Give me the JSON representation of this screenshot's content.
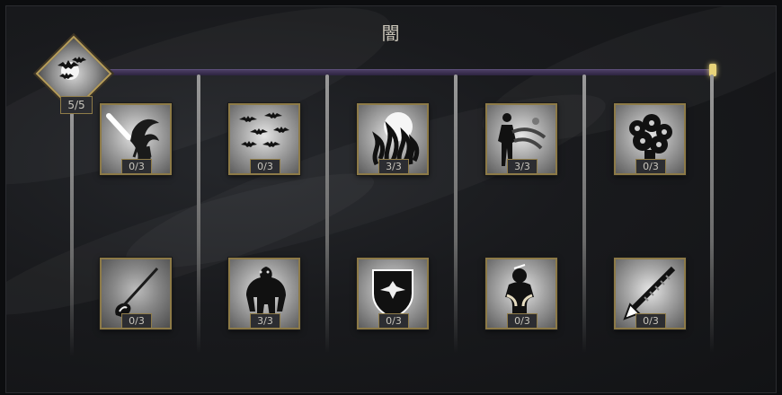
{
  "tree": {
    "title": "闇"
  },
  "root": {
    "name": "Bat Swarm Root",
    "rank": "5/5",
    "icon": "bat-swarm-icon"
  },
  "skills": [
    {
      "icon": "dark-claw-strike-icon",
      "rank": "0/3"
    },
    {
      "icon": "bat-flock-icon",
      "rank": "0/3"
    },
    {
      "icon": "dark-flames-icon",
      "rank": "3/3"
    },
    {
      "icon": "shadow-figure-icon",
      "rank": "3/3"
    },
    {
      "icon": "shadow-cloud-icon",
      "rank": "0/3"
    },
    {
      "icon": "dark-spear-comet-icon",
      "rank": "0/3"
    },
    {
      "icon": "dark-beast-icon",
      "rank": "3/3"
    },
    {
      "icon": "raven-shield-icon",
      "rank": "0/3"
    },
    {
      "icon": "warrior-silhouette-icon",
      "rank": "0/3"
    },
    {
      "icon": "spear-head-icon",
      "rank": "0/3"
    }
  ],
  "colors": {
    "accent": "#b69d5a",
    "progress": "#4a3d62",
    "progress_cap": "#e8d37a",
    "background": "#141517"
  }
}
